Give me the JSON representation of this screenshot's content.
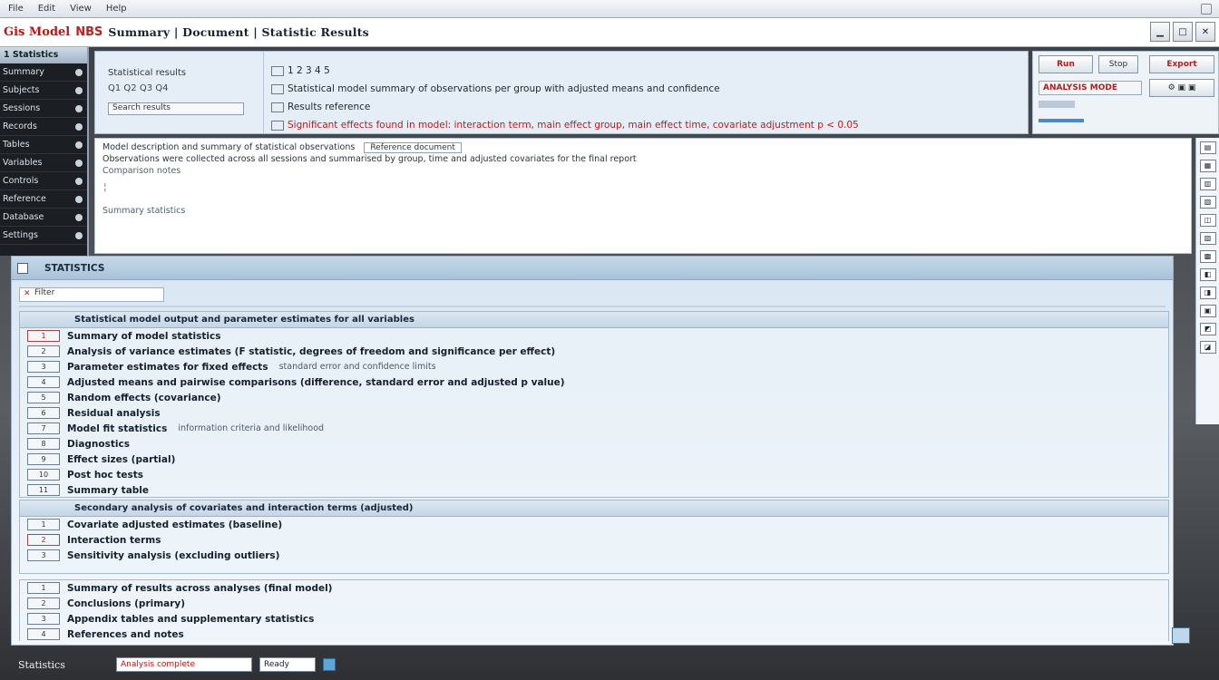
{
  "menubar": {
    "items": [
      "File",
      "Edit",
      "View",
      "Help"
    ]
  },
  "window": {
    "logo": "Gis Model",
    "tag": "NBS",
    "title": "Summary | Document | Statistic Results"
  },
  "sidebar": {
    "header": "1 Statistics",
    "items": [
      "Summary",
      "Subjects",
      "Sessions",
      "Records",
      "Tables",
      "Variables",
      "Controls",
      "Reference",
      "Database",
      "Settings"
    ]
  },
  "info": {
    "left_title": "Statistical results",
    "left_meta": "Q1 Q2 Q3 Q4",
    "left_field": "Search results",
    "line1": "1 2 3 4 5",
    "line2": "Statistical model summary of observations per group with adjusted means and confidence",
    "line3": "Results reference",
    "line4": "Significant effects found in model: interaction term, main effect group, main effect time, covariate adjustment p < 0.05"
  },
  "toolbox": {
    "btn1": "Run",
    "btn2": "Stop",
    "btn3": "Export",
    "red_label": "ANALYSIS MODE"
  },
  "text": {
    "line1": "Model description and summary of statistical observations",
    "inline_field": "Reference document",
    "line2": "Observations were collected across all sessions and summarised by group, time and adjusted covariates for the final report",
    "line3": "Comparison notes",
    "line4": "Summary statistics"
  },
  "results": {
    "header": "STATISTICS",
    "filter": "Filter",
    "group1": {
      "head": "Statistical model output and parameter estimates for all variables",
      "rows": [
        {
          "badge": "1",
          "text": "Summary of model statistics",
          "muted": ""
        },
        {
          "badge": "2",
          "text": "Analysis of variance estimates (F statistic, degrees of freedom and significance per effect)",
          "muted": ""
        },
        {
          "badge": "3",
          "text": "Parameter estimates for fixed effects",
          "muted": "standard error and confidence limits"
        },
        {
          "badge": "4",
          "text": "Adjusted means and pairwise comparisons (difference, standard error and adjusted p value)",
          "muted": ""
        },
        {
          "badge": "5",
          "text": "Random effects (covariance)",
          "muted": ""
        },
        {
          "badge": "6",
          "text": "Residual analysis",
          "muted": ""
        },
        {
          "badge": "7",
          "text": "Model fit statistics",
          "muted": "information criteria and likelihood"
        },
        {
          "badge": "8",
          "text": "Diagnostics",
          "muted": ""
        },
        {
          "badge": "9",
          "text": "Effect sizes (partial)",
          "muted": ""
        },
        {
          "badge": "10",
          "text": "Post hoc tests",
          "muted": ""
        },
        {
          "badge": "11",
          "text": "Summary table",
          "muted": ""
        }
      ]
    },
    "group2": {
      "head": "Secondary analysis of covariates and interaction terms (adjusted)",
      "rows": [
        {
          "badge": "1",
          "text": "Covariate adjusted estimates (baseline)",
          "muted": ""
        },
        {
          "badge": "2",
          "text": "Interaction terms",
          "muted": ""
        },
        {
          "badge": "3",
          "text": "Sensitivity analysis (excluding outliers)",
          "muted": ""
        }
      ]
    },
    "group3": {
      "rows": [
        {
          "badge": "1",
          "text": "Summary of results across analyses (final model)",
          "muted": ""
        },
        {
          "badge": "2",
          "text": "Conclusions (primary)",
          "muted": ""
        },
        {
          "badge": "3",
          "text": "Appendix tables and supplementary statistics",
          "muted": ""
        },
        {
          "badge": "4",
          "text": "References and notes",
          "muted": ""
        }
      ]
    }
  },
  "status": {
    "label": "Statistics",
    "field_red": "Analysis complete",
    "field_plain": "Ready"
  }
}
